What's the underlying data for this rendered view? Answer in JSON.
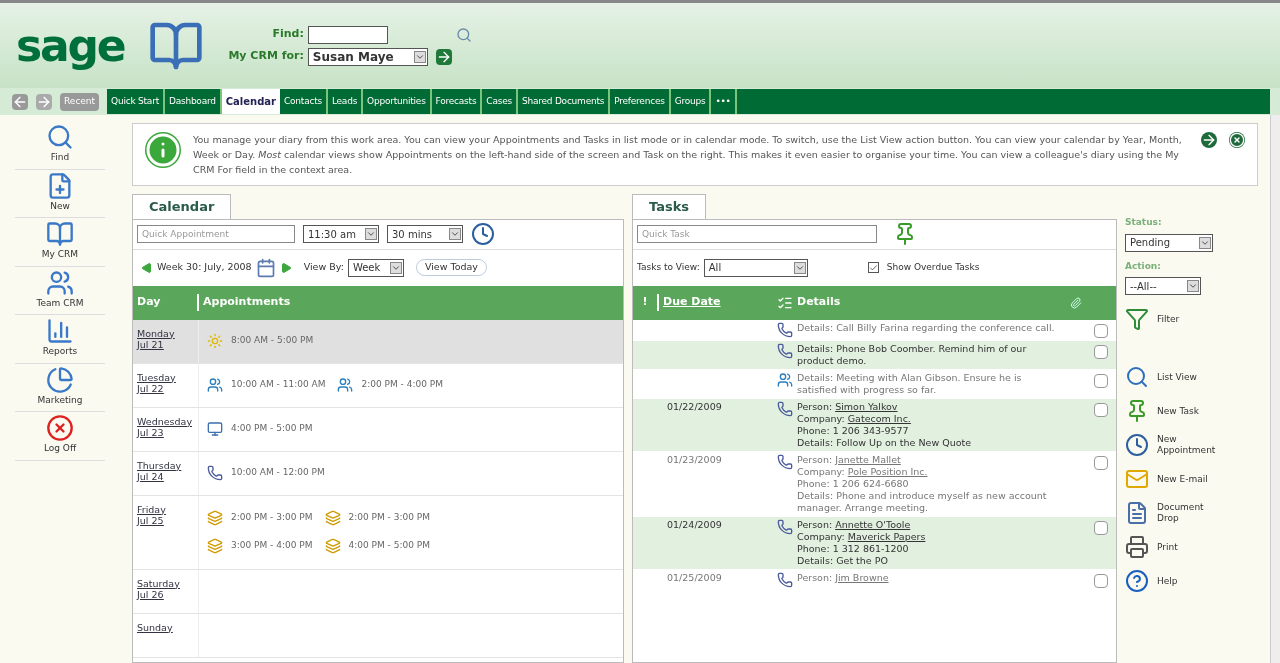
{
  "header": {
    "logo": "sage",
    "find_label": "Find:",
    "crm_for_label": "My CRM for:",
    "crm_for_value": "Susan Maye"
  },
  "nav": {
    "recent": "Recent",
    "tabs": [
      {
        "label": "Quick Start",
        "selected": false
      },
      {
        "label": "Dashboard",
        "selected": false
      },
      {
        "label": "Calendar",
        "selected": true
      },
      {
        "label": "Contacts",
        "selected": false
      },
      {
        "label": "Leads",
        "selected": false
      },
      {
        "label": "Opportunities",
        "selected": false
      },
      {
        "label": "Forecasts",
        "selected": false
      },
      {
        "label": "Cases",
        "selected": false
      },
      {
        "label": "Shared Documents",
        "selected": false
      },
      {
        "label": "Preferences",
        "selected": false
      },
      {
        "label": "Groups",
        "selected": false
      },
      {
        "label": "•••",
        "selected": false
      }
    ]
  },
  "sidebar": {
    "items": [
      {
        "kind": "find",
        "label": "Find"
      },
      {
        "kind": "new",
        "label": "New"
      },
      {
        "kind": "mycrm",
        "label": "My CRM"
      },
      {
        "kind": "team",
        "label": "Team CRM"
      },
      {
        "kind": "reports",
        "label": "Reports"
      },
      {
        "kind": "marketing",
        "label": "Marketing"
      },
      {
        "kind": "logoff",
        "label": "Log Off"
      }
    ]
  },
  "info": {
    "text": "You manage your diary from this work area. You can view your Appointments and Tasks in list mode or in calendar mode. To switch, use the List View action button. You can view your calendar by Year, Month, Week or Day. *Most* calendar views show Appointments on the left-hand side of the screen and Task on the right. This makes it even easier to organise your time. You can view a colleague's diary using the My CRM For field in the context area."
  },
  "calendar": {
    "tab": "Calendar",
    "quick_placeholder": "Quick Appointment",
    "time": "11:30 am",
    "duration": "30 mins",
    "week_label": "Week 30: July, 2008",
    "view_by_label": "View By:",
    "view_by": "Week",
    "view_today": "View Today",
    "columns": {
      "day": "Day",
      "appointments": "Appointments"
    },
    "days": [
      {
        "day": "Monday",
        "date": "Jul 21",
        "today": true,
        "appointments": [
          {
            "kind": "allday",
            "time": "8:00 AM - 5:00 PM"
          }
        ]
      },
      {
        "day": "Tuesday",
        "date": "Jul 22",
        "today": false,
        "appointments": [
          {
            "kind": "meeting",
            "time": "10:00 AM - 11:00 AM"
          },
          {
            "kind": "meeting",
            "time": "2:00 PM - 4:00 PM"
          }
        ]
      },
      {
        "day": "Wednesday",
        "date": "Jul 23",
        "today": false,
        "appointments": [
          {
            "kind": "computer",
            "time": "4:00 PM - 5:00 PM"
          }
        ]
      },
      {
        "day": "Thursday",
        "date": "Jul 24",
        "today": false,
        "appointments": [
          {
            "kind": "call",
            "time": "10:00 AM - 12:00 PM"
          }
        ]
      },
      {
        "day": "Friday",
        "date": "Jul 25",
        "today": false,
        "appointments": [
          {
            "kind": "event",
            "time": "2:00 PM - 3:00 PM"
          },
          {
            "kind": "event",
            "time": "2:00 PM - 3:00 PM"
          },
          {
            "kind": "event",
            "time": "3:00 PM - 4:00 PM"
          },
          {
            "kind": "event",
            "time": "4:00 PM - 5:00 PM"
          }
        ]
      },
      {
        "day": "Saturday",
        "date": "Jul 26",
        "today": false
      },
      {
        "day": "Sunday",
        "today": false
      }
    ]
  },
  "tasks": {
    "tab": "Tasks",
    "quick_placeholder": "Quick Task",
    "view_label": "Tasks to View:",
    "view_value": "All",
    "show_overdue": {
      "label": "Show Overdue Tasks",
      "checked": true
    },
    "columns": {
      "priority": "!",
      "due_date": "Due Date",
      "details": "Details"
    },
    "rows": [
      {
        "kind": "call",
        "checked": false,
        "lines": [
          {
            "label": "Details:",
            "text": "Call Billy Farina regarding the conference call."
          }
        ]
      },
      {
        "kind": "call",
        "checked": false,
        "lines": [
          {
            "label": "Details:",
            "text": "Phone Bob Coomber. Remind him of our product demo."
          }
        ]
      },
      {
        "kind": "meeting",
        "checked": false,
        "lines": [
          {
            "label": "Details:",
            "text": "Meeting with Alan Gibson. Ensure he is satisfied with progress so far."
          }
        ]
      },
      {
        "kind": "call",
        "due_date": "01/22/2009",
        "checked": false,
        "lines": [
          {
            "label": "Person:",
            "link": "Simon Yalkov"
          },
          {
            "label": "Company:",
            "link": "Gatecom Inc."
          },
          {
            "label": "Phone:",
            "text": "1 206 343-9577"
          },
          {
            "label": "Details:",
            "text": "Follow Up on the New Quote"
          }
        ]
      },
      {
        "kind": "call",
        "due_date": "01/23/2009",
        "checked": false,
        "lines": [
          {
            "label": "Person:",
            "link": "Janette Mallet"
          },
          {
            "label": "Company:",
            "link": "Pole Position Inc."
          },
          {
            "label": "Phone:",
            "text": "1 206 624-6680"
          },
          {
            "label": "Details:",
            "text": "Phone and introduce myself as new account manager. Arrange meeting."
          }
        ]
      },
      {
        "kind": "call",
        "due_date": "01/24/2009",
        "checked": false,
        "lines": [
          {
            "label": "Person:",
            "link": "Annette O'Toole"
          },
          {
            "label": "Company:",
            "link": "Maverick Papers"
          },
          {
            "label": "Phone:",
            "text": "1 312 861-1200"
          },
          {
            "label": "Details:",
            "text": "Get the PO"
          }
        ]
      },
      {
        "kind": "call",
        "due_date": "01/25/2009",
        "checked": false,
        "lines": [
          {
            "label": "Person:",
            "link": "Jim Browne"
          }
        ]
      }
    ]
  },
  "actions": {
    "status_label": "Status:",
    "status": "Pending",
    "action_label": "Action:",
    "action": "--All--",
    "items": [
      {
        "kind": "filter",
        "label": "Filter"
      },
      {
        "kind": "listview",
        "label": "List View"
      },
      {
        "kind": "newtask",
        "label": "New Task"
      },
      {
        "kind": "appointment",
        "label": "New Appointment"
      },
      {
        "kind": "email",
        "label": "New E-mail"
      },
      {
        "kind": "document",
        "label": "Document Drop"
      },
      {
        "kind": "print",
        "label": "Print"
      },
      {
        "kind": "help",
        "label": "Help"
      }
    ]
  }
}
